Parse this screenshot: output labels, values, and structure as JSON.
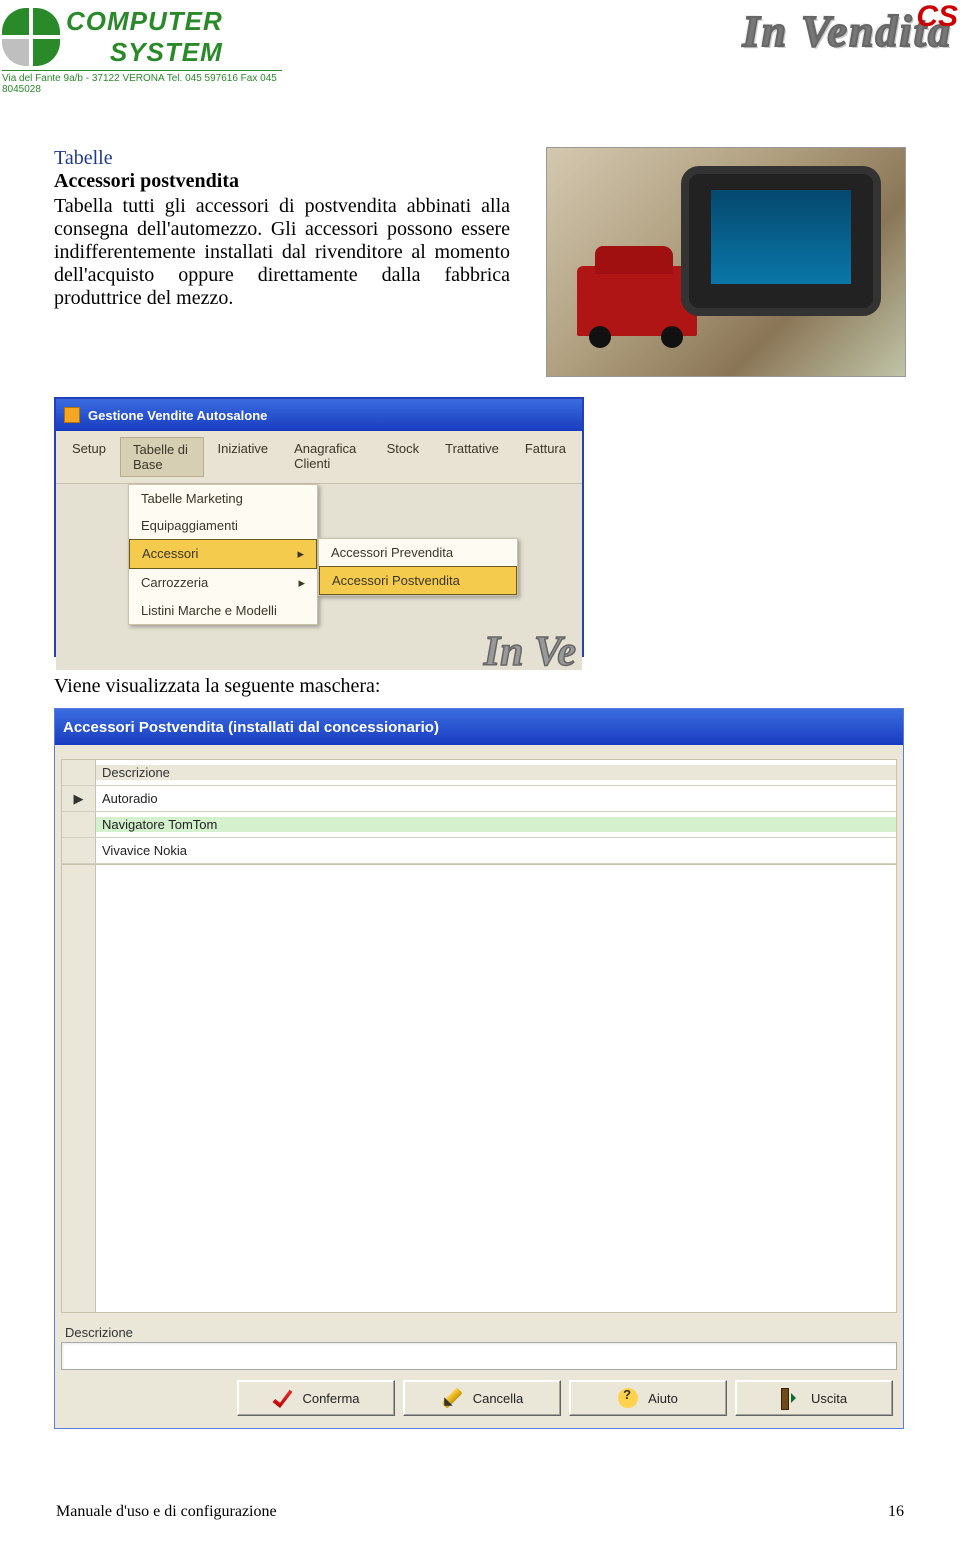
{
  "header": {
    "company_line1": "COMPUTER",
    "company_line2": "SYSTEM",
    "address": "Via del Fante 9a/b - 37122 VERONA   Tel. 045 597616   Fax 045 8045028",
    "brand_text": "In Vendita",
    "brand_badge": "CS"
  },
  "section": {
    "heading": "Tabelle",
    "subheading": "Accessori postvendita",
    "paragraph": "Tabella tutti gli accessori di postvendita abbinati alla consegna dell'automezzo. Gli accessori possono essere indifferentemente installati dal rivenditore al momento dell'acquisto oppure direttamente dalla fabbrica produttrice del mezzo."
  },
  "app1": {
    "title": "Gestione Vendite Autosalone",
    "menu": [
      "Setup",
      "Tabelle di Base",
      "Iniziative",
      "Anagrafica Clienti",
      "Stock",
      "Trattative",
      "Fattura"
    ],
    "menu_active_index": 1,
    "dropdown1": [
      "Tabelle Marketing",
      "Equipaggiamenti",
      "Accessori",
      "Carrozzeria",
      "Listini Marche e  Modelli"
    ],
    "dropdown1_selected_index": 2,
    "dropdown2": [
      "Accessori Prevendita",
      "Accessori Postvendita"
    ],
    "dropdown2_selected_index": 1,
    "wm": "In Ve"
  },
  "caption": "Viene visualizzata la seguente maschera:",
  "dialog": {
    "title": "Accessori Postvendita (installati dal concessionario)",
    "grid_header": "Descrizione",
    "rows": [
      "Autoradio",
      "Navigatore TomTom",
      "Vivavice Nokia"
    ],
    "selected_row_index": 1,
    "row_marker": "▶",
    "form_label": "Descrizione",
    "form_value": "",
    "buttons": {
      "confirm": "Conferma",
      "cancel": "Cancella",
      "help": "Aiuto",
      "exit": "Uscita"
    }
  },
  "footer": {
    "left": "Manuale d'uso e di configurazione",
    "right": "16"
  }
}
